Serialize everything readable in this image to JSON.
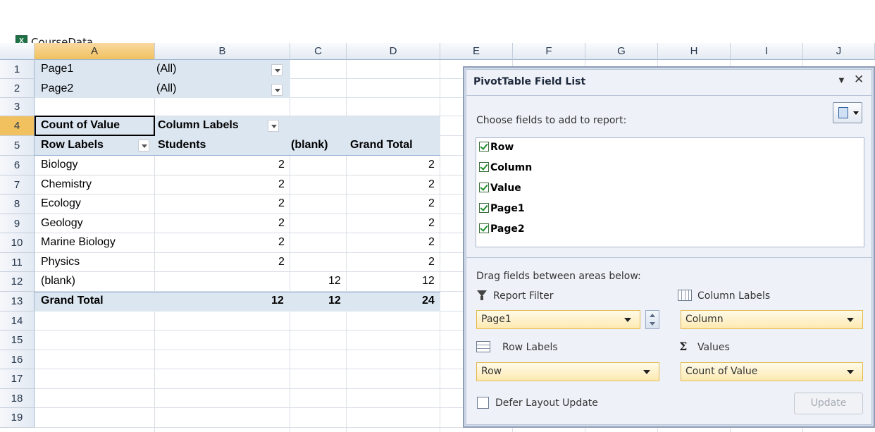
{
  "window": {
    "title": "CourseData",
    "icon": "excel-icon"
  },
  "columns": [
    "A",
    "B",
    "C",
    "D",
    "E",
    "F",
    "G",
    "H",
    "I",
    "J"
  ],
  "rows": [
    "1",
    "2",
    "3",
    "4",
    "5",
    "6",
    "7",
    "8",
    "9",
    "10",
    "11",
    "12",
    "13",
    "14",
    "15",
    "16",
    "17",
    "18",
    "19"
  ],
  "page_filters": [
    {
      "label": "Page1",
      "value": "(All)"
    },
    {
      "label": "Page2",
      "value": "(All)"
    }
  ],
  "pivot": {
    "count_of_value": "Count of Value",
    "column_labels": "Column Labels",
    "row_labels": "Row Labels",
    "col_students": "Students",
    "col_blank": "(blank)",
    "col_grand_total": "Grand Total",
    "rows": [
      {
        "label": "Biology",
        "students": "2",
        "blank": "",
        "total": "2"
      },
      {
        "label": "Chemistry",
        "students": "2",
        "blank": "",
        "total": "2"
      },
      {
        "label": "Ecology",
        "students": "2",
        "blank": "",
        "total": "2"
      },
      {
        "label": "Geology",
        "students": "2",
        "blank": "",
        "total": "2"
      },
      {
        "label": "Marine Biology",
        "students": "2",
        "blank": "",
        "total": "2"
      },
      {
        "label": "Physics",
        "students": "2",
        "blank": "",
        "total": "2"
      },
      {
        "label": "(blank)",
        "students": "",
        "blank": "12",
        "total": "12"
      }
    ],
    "grand_total": {
      "label": "Grand Total",
      "students": "12",
      "blank": "12",
      "total": "24"
    }
  },
  "field_list": {
    "title": "PivotTable Field List",
    "choose_label": "Choose fields to add to report:",
    "fields": [
      "Row",
      "Column",
      "Value",
      "Page1",
      "Page2"
    ],
    "drag_label": "Drag fields between areas below:",
    "report_filter_label": "Report Filter",
    "report_filter_value": "Page1",
    "column_labels_label": "Column Labels",
    "column_labels_value": "Column",
    "row_labels_label": "Row Labels",
    "row_labels_value": "Row",
    "values_label": "Values",
    "values_value": "Count of Value",
    "defer_label": "Defer Layout Update",
    "update_label": "Update"
  },
  "colors": {
    "pivot_header": "#dce6f1",
    "accent": "#f1c15f",
    "excel_green": "#1e7145"
  }
}
